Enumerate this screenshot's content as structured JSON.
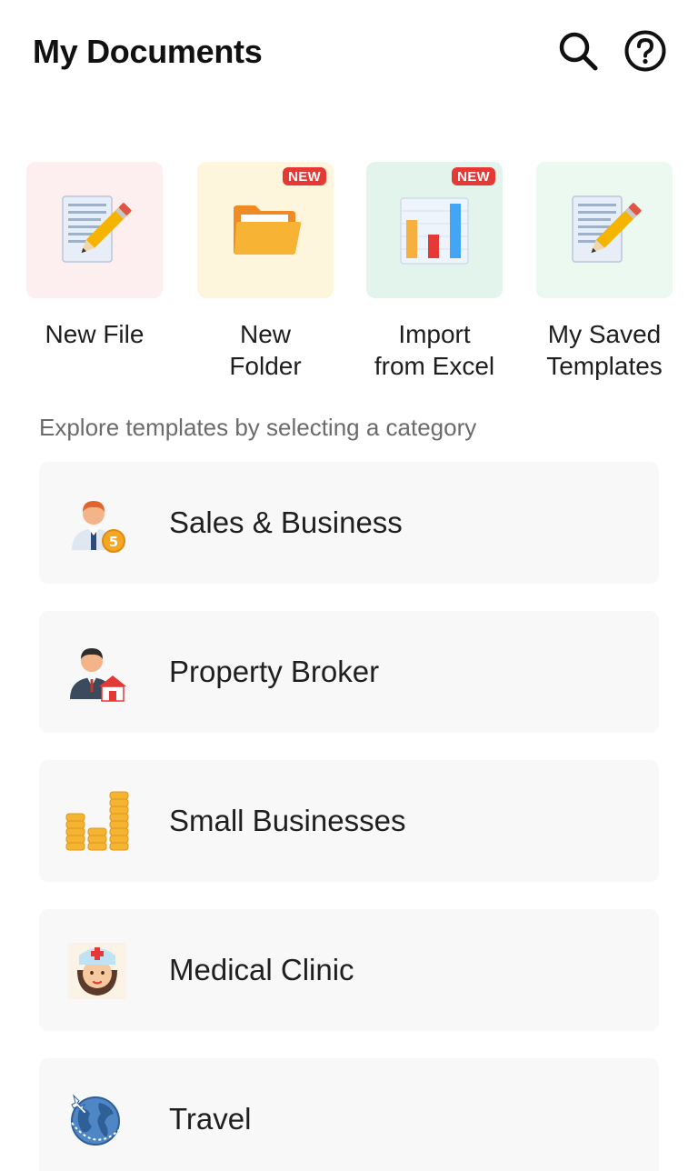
{
  "header": {
    "title": "My Documents",
    "search_icon": "search-icon",
    "help_icon": "help-circle-icon"
  },
  "actions": [
    {
      "line1": "New File",
      "line2": "",
      "badge": "",
      "icon": "document-pencil-icon",
      "bg": "#fdeff0"
    },
    {
      "line1": "New",
      "line2": "Folder",
      "badge": "NEW",
      "icon": "folder-icon",
      "bg": "#fdf5dc"
    },
    {
      "line1": "Import",
      "line2": "from Excel",
      "badge": "NEW",
      "icon": "bar-chart-icon",
      "bg": "#e3f4ec"
    },
    {
      "line1": "My Saved",
      "line2": "Templates",
      "badge": "",
      "icon": "document-pencil-icon",
      "bg": "#ebf9f1"
    }
  ],
  "explore_text": "Explore templates by selecting a category",
  "categories": [
    {
      "label": "Sales & Business",
      "icon": "businessman-coin-icon"
    },
    {
      "label": "Property Broker",
      "icon": "broker-house-icon"
    },
    {
      "label": "Small Businesses",
      "icon": "coin-stacks-icon"
    },
    {
      "label": "Medical Clinic",
      "icon": "nurse-icon"
    },
    {
      "label": "Travel",
      "icon": "globe-plane-icon"
    }
  ],
  "colors": {
    "badge": "#e53935",
    "tile_pink": "#fdeff0",
    "tile_yellow": "#fdf5dc",
    "tile_green": "#e3f4ec",
    "tile_mint": "#ebf9f1",
    "card_bg": "#f8f8f8"
  }
}
